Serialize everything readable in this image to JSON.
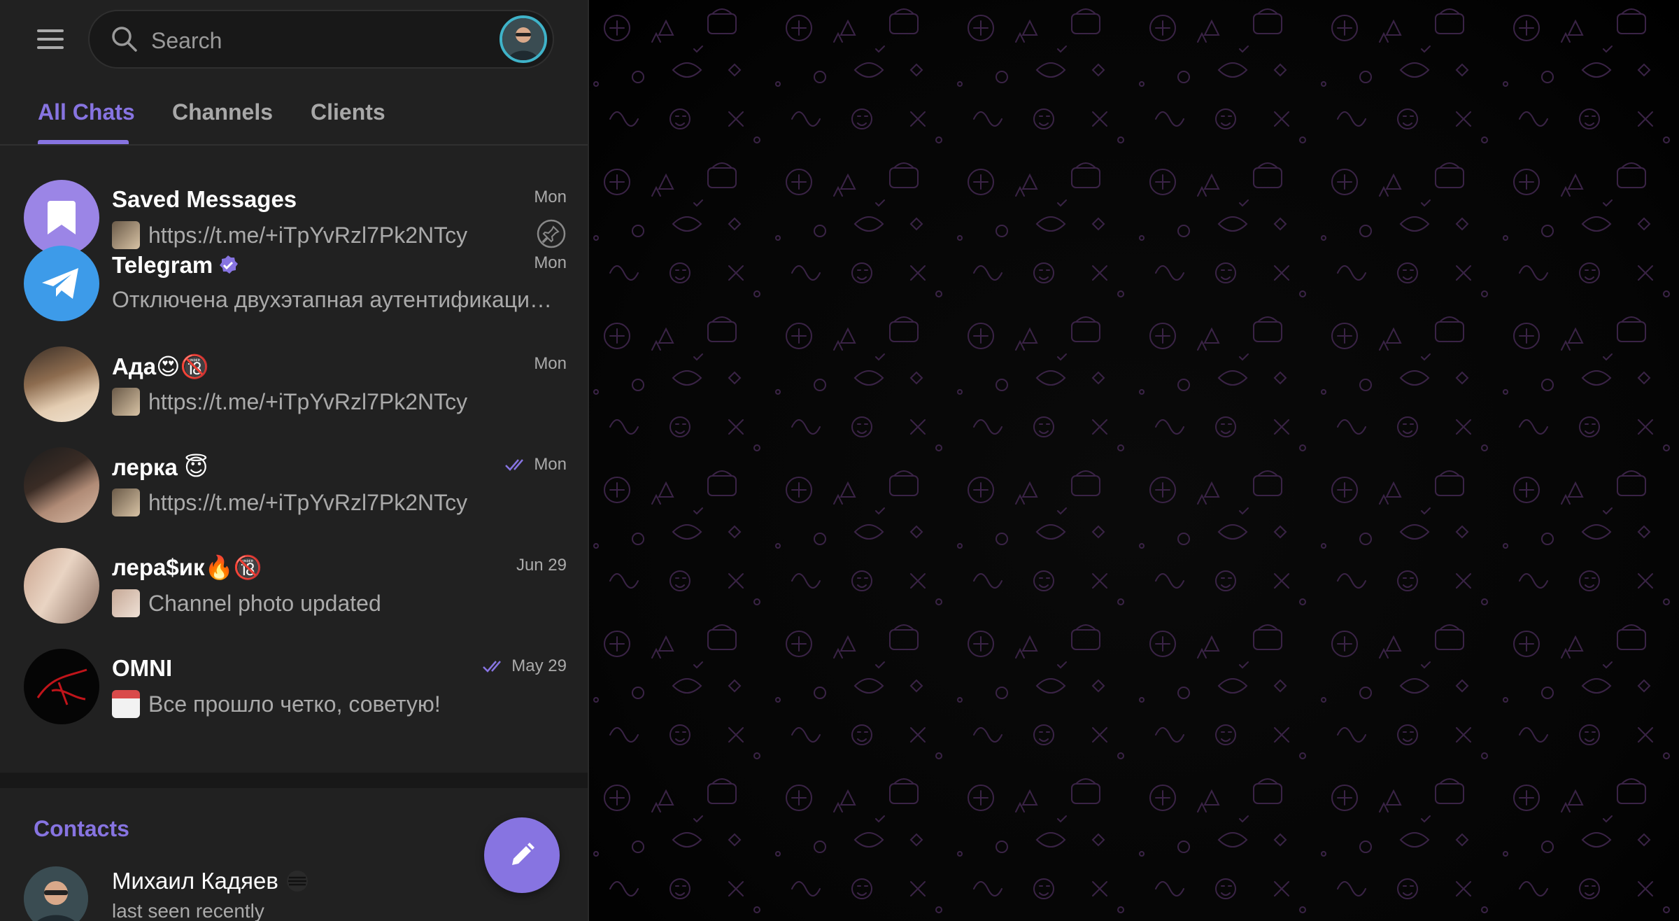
{
  "search": {
    "placeholder": "Search"
  },
  "tabs": [
    {
      "label": "All Chats",
      "active": true
    },
    {
      "label": "Channels",
      "active": false
    },
    {
      "label": "Clients",
      "active": false
    }
  ],
  "chats": [
    {
      "name": "Saved Messages",
      "time": "Mon",
      "preview": "https://t.me/+iTpYvRzl7Pk2NTcy",
      "avatar_icon": "bookmark-icon",
      "pinned": true
    },
    {
      "name": "Telegram",
      "verified": true,
      "time": "Mon",
      "preview": "Отключена двухэтапная аутентификаци…",
      "avatar_icon": "telegram-logo-icon"
    },
    {
      "name": "Ада😍🔞",
      "time": "Mon",
      "preview": "https://t.me/+iTpYvRzl7Pk2NTcy"
    },
    {
      "name": "лерка 😇",
      "time": "Mon",
      "read": true,
      "preview": "https://t.me/+iTpYvRzl7Pk2NTcy"
    },
    {
      "name": "лера$ик🔥🔞",
      "time": "Jun 29",
      "preview": "Channel photo updated"
    },
    {
      "name": "OMNI",
      "time": "May 29",
      "read": true,
      "preview": "Все прошло четко, советую!"
    }
  ],
  "contacts": {
    "title": "Contacts",
    "items": [
      {
        "name": "Михаил Кадяев",
        "status": "last seen recently"
      }
    ]
  },
  "colors": {
    "accent": "#8774e1",
    "sidebar_bg": "#212121",
    "text_primary": "#ffffff",
    "text_secondary": "#aaaaaa",
    "telegram_blue": "#3d9be9"
  }
}
